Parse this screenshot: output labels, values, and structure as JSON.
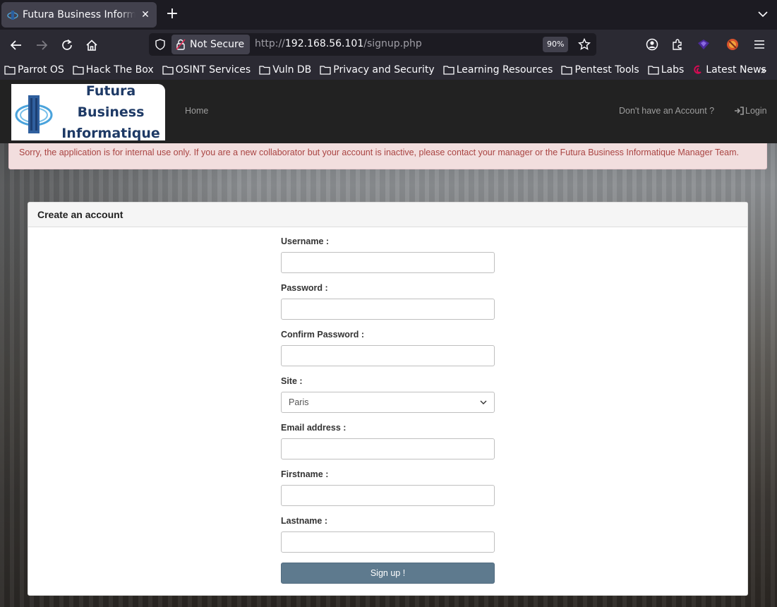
{
  "browser": {
    "tab": {
      "title": "Futura Business Informatique",
      "icon": "building-favicon"
    },
    "url": {
      "scheme": "http://",
      "host": "192.168.56.101",
      "path": "/signup.php"
    },
    "security_label": "Not Secure",
    "zoom": "90%",
    "extension_badge": "3",
    "bookmarks": [
      {
        "label": "Parrot OS",
        "icon": "folder-icon"
      },
      {
        "label": "Hack The Box",
        "icon": "folder-icon"
      },
      {
        "label": "OSINT Services",
        "icon": "folder-icon"
      },
      {
        "label": "Vuln DB",
        "icon": "folder-icon"
      },
      {
        "label": "Privacy and Security",
        "icon": "folder-icon"
      },
      {
        "label": "Learning Resources",
        "icon": "folder-icon"
      },
      {
        "label": "Pentest Tools",
        "icon": "folder-icon"
      },
      {
        "label": "Labs",
        "icon": "folder-icon"
      },
      {
        "label": "Latest News",
        "icon": "debian-swirl-icon"
      }
    ]
  },
  "site": {
    "logo": {
      "line1": "Futura Business",
      "line2": "Informatique"
    },
    "nav": {
      "home": "Home",
      "no_account": "Don't have an Account ?",
      "login": "Login"
    },
    "alert": "Sorry, the application is for internal use only. If you are a new collaborator but your account is inactive, please contact your manager or the Futura Business Informatique Manager Team.",
    "panel_title": "Create an account",
    "form": {
      "username_label": "Username :",
      "password_label": "Password :",
      "confirm_password_label": "Confirm Password :",
      "site_label": "Site :",
      "site_value": "Paris",
      "email_label": "Email address :",
      "firstname_label": "Firstname :",
      "lastname_label": "Lastname :",
      "submit_label": "Sign up !"
    }
  },
  "colors": {
    "alert_bg": "#f2dede",
    "alert_text": "#a94442",
    "button_bg": "#5e7a8e",
    "navbar_bg": "#222222",
    "logo_text": "#1e3a66"
  }
}
